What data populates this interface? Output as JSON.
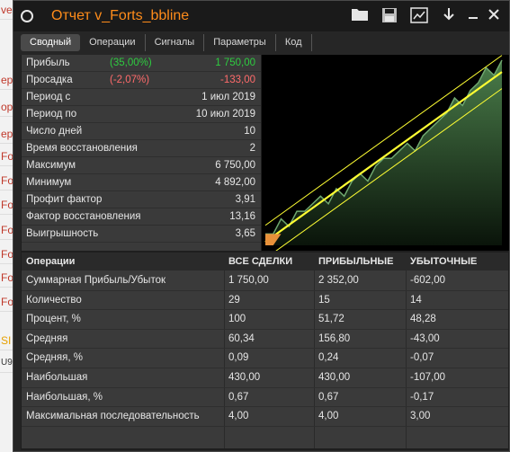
{
  "window": {
    "title": "Отчет v_Forts_bbline",
    "icons": [
      "circle-icon",
      "folder-icon",
      "save-icon",
      "settings-icon",
      "download-icon",
      "minimize-icon",
      "close-icon"
    ]
  },
  "background_cells": [
    "ve",
    "ер",
    "ор",
    "ep",
    "Fo",
    "Fo",
    "Fo",
    "Fo",
    "Fo",
    "Fo",
    "Fo",
    "SI",
    "U9"
  ],
  "tabs": [
    {
      "label": "Сводный",
      "active": true
    },
    {
      "label": "Операции",
      "active": false
    },
    {
      "label": "Сигналы",
      "active": false
    },
    {
      "label": "Параметры",
      "active": false
    },
    {
      "label": "Код",
      "active": false
    }
  ],
  "stats": [
    {
      "label": "Прибыль",
      "pct": "(35,00%)",
      "pct_color": "green",
      "value": "1 750,00",
      "value_color": "green"
    },
    {
      "label": "Просадка",
      "pct": "(-2,07%)",
      "pct_color": "red",
      "value": "-133,00",
      "value_color": "red"
    },
    {
      "label": "Период с",
      "pct": "",
      "value": "1 июл 2019"
    },
    {
      "label": "Период по",
      "pct": "",
      "value": "10 июл 2019"
    },
    {
      "label": "Число дней",
      "pct": "",
      "value": "10"
    },
    {
      "label": "Время восстановления",
      "pct": "",
      "value": "2"
    },
    {
      "label": "Максимум",
      "pct": "",
      "value": "6 750,00"
    },
    {
      "label": "Минимум",
      "pct": "",
      "value": "4 892,00"
    },
    {
      "label": "Профит фактор",
      "pct": "",
      "value": "3,91"
    },
    {
      "label": "Фактор восстановления",
      "pct": "",
      "value": "13,16"
    },
    {
      "label": "Выигрышность",
      "pct": "",
      "value": "3,65"
    }
  ],
  "chart_data": {
    "type": "area",
    "colors": {
      "equity_fill": "#3d6b3d",
      "equity_line": "#6fa86f",
      "trend": "#ffff33",
      "drawdown": "#e8913a"
    },
    "equity": [
      0,
      0,
      2,
      1,
      3,
      3,
      4,
      5,
      4,
      6,
      5,
      7,
      8,
      7,
      9,
      10,
      10,
      11,
      12,
      11,
      13,
      14,
      15,
      16,
      18,
      17,
      19,
      20,
      22,
      21,
      23
    ],
    "drawdown": [
      -1.5,
      -1.5,
      0,
      0,
      0,
      0,
      0,
      0,
      0,
      0,
      0,
      0,
      0,
      0,
      0,
      0,
      0,
      0,
      0,
      0,
      0,
      0,
      0,
      0,
      0,
      0,
      0,
      0,
      0,
      0,
      0
    ]
  },
  "ops": {
    "headers": [
      "Операции",
      "ВСЕ СДЕЛКИ",
      "ПРИБЫЛЬНЫЕ",
      "УБЫТОЧНЫЕ"
    ],
    "rows": [
      [
        "Суммарная Прибыль/Убыток",
        "1 750,00",
        "2 352,00",
        "-602,00"
      ],
      [
        "Количество",
        "29",
        "15",
        "14"
      ],
      [
        "Процент, %",
        "100",
        "51,72",
        "48,28"
      ],
      [
        "Средняя",
        "60,34",
        "156,80",
        "-43,00"
      ],
      [
        "Средняя, %",
        "0,09",
        "0,24",
        "-0,07"
      ],
      [
        "Наибольшая",
        "430,00",
        "430,00",
        "-107,00"
      ],
      [
        "Наибольшая, %",
        "0,67",
        "0,67",
        "-0,17"
      ],
      [
        "Максимальная последовательность",
        "4,00",
        "4,00",
        "3,00"
      ]
    ]
  }
}
